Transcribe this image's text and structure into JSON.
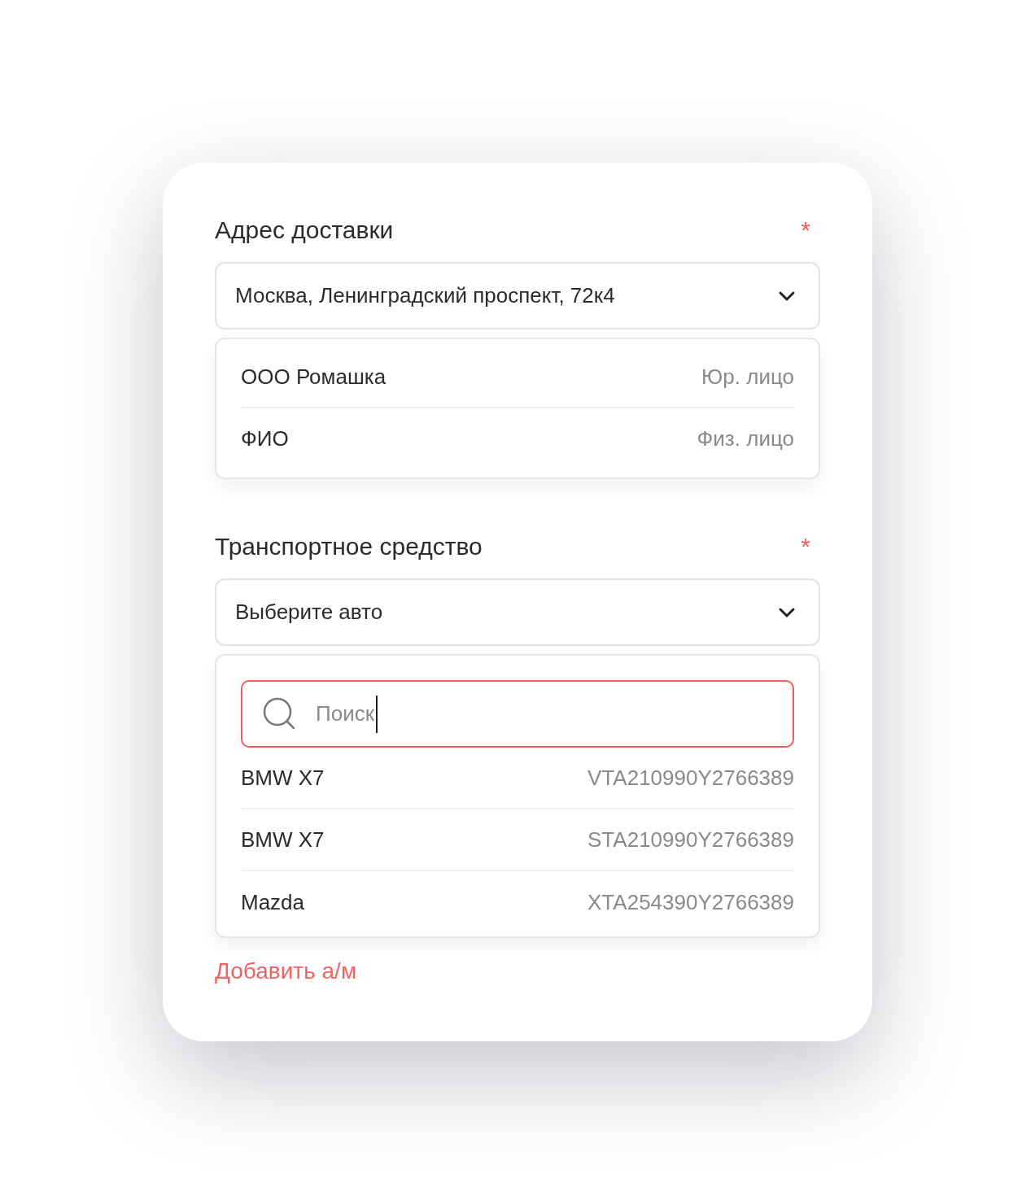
{
  "fields": [
    {
      "label": "Адрес доставки",
      "required_mark": "*",
      "select": {
        "value": "Москва, Ленинградский проспект, 72к4"
      },
      "options": [
        {
          "name": "ООО Ромашка",
          "detail": "Юр. лицо"
        },
        {
          "name": "ФИО",
          "detail": "Физ. лицо"
        }
      ]
    },
    {
      "label": "Транспортное средство",
      "required_mark": "*",
      "select": {
        "value": "Выберите авто"
      },
      "search": {
        "placeholder": "Поиск"
      },
      "options": [
        {
          "name": "BMW X7",
          "detail": "VTA210990Y2766389"
        },
        {
          "name": "BMW X7",
          "detail": "STA210990Y2766389"
        },
        {
          "name": "Mazda",
          "detail": "XTA254390Y2766389"
        }
      ]
    }
  ],
  "add_link": "Добавить а/м"
}
